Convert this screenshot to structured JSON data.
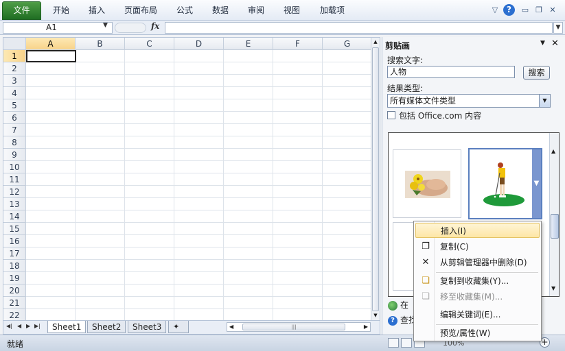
{
  "ribbon": {
    "tabs": [
      "文件",
      "开始",
      "插入",
      "页面布局",
      "公式",
      "数据",
      "审阅",
      "视图",
      "加载项"
    ]
  },
  "formula_bar": {
    "name_box": "A1",
    "fx_label": "fx",
    "formula": ""
  },
  "grid": {
    "columns": [
      "A",
      "B",
      "C",
      "D",
      "E",
      "F",
      "G"
    ],
    "rows": [
      "1",
      "2",
      "3",
      "4",
      "5",
      "6",
      "7",
      "8",
      "9",
      "10",
      "11",
      "12",
      "13",
      "14",
      "15",
      "16",
      "17",
      "18",
      "19",
      "20",
      "21",
      "22"
    ],
    "active_cell": "A1"
  },
  "sheets": {
    "tabs": [
      "Sheet1",
      "Sheet2",
      "Sheet3"
    ],
    "active": "Sheet1"
  },
  "status": {
    "ready": "就绪",
    "zoom": "100%"
  },
  "clipart_pane": {
    "title": "剪贴画",
    "search_label": "搜索文字:",
    "search_value": "人物",
    "search_button": "搜索",
    "result_type_label": "结果类型:",
    "result_type_value": "所有媒体文件类型",
    "include_label": "包括 Office.com 内容",
    "include_checked": false,
    "links": [
      "在",
      "查找"
    ]
  },
  "context_menu": {
    "items": [
      {
        "label": "插入(I)",
        "icon": "insert-icon",
        "highlighted": true,
        "disabled": false
      },
      {
        "label": "复制(C)",
        "icon": "copy-icon",
        "highlighted": false,
        "disabled": false
      },
      {
        "label": "从剪辑管理器中删除(D)",
        "icon": "delete-x-icon",
        "highlighted": false,
        "disabled": false
      },
      {
        "label": "复制到收藏集(Y)...",
        "icon": "copy-to-collection-icon",
        "highlighted": false,
        "disabled": false
      },
      {
        "label": "移至收藏集(M)...",
        "icon": "move-to-collection-icon",
        "highlighted": false,
        "disabled": true
      },
      {
        "label": "编辑关键词(E)...",
        "icon": "",
        "highlighted": false,
        "disabled": false
      },
      {
        "label": "预览/属性(W)",
        "icon": "",
        "highlighted": false,
        "disabled": false
      }
    ]
  },
  "colors": {
    "file_tab": "#1f6e23",
    "selection_header": "#f8d38a",
    "menu_highlight": "#fde6a6"
  }
}
